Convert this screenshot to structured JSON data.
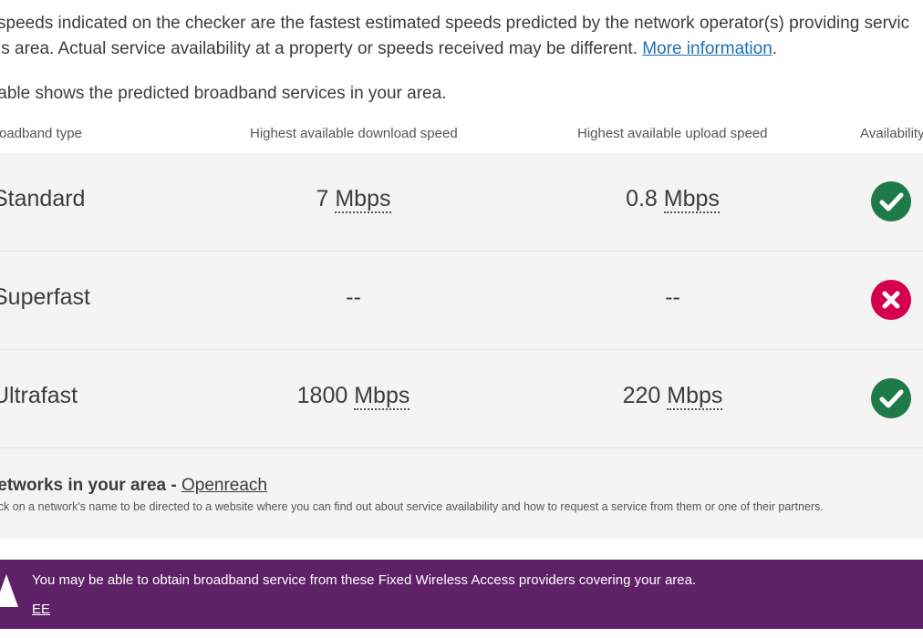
{
  "intro": {
    "line1": "speeds indicated on the checker are the fastest estimated speeds predicted by the network operator(s) providing servic",
    "line2_text": "is area. Actual service availability at a property or speeds received may be different.",
    "more_link": "More information",
    "line2_end": "."
  },
  "subtitle": "table shows the predicted broadband services in your area.",
  "table": {
    "headers": {
      "type": "roadband type",
      "download": "Highest available download speed",
      "upload": "Highest available upload speed",
      "availability": "Availability"
    },
    "rows": [
      {
        "type": "Standard",
        "down_value": "7",
        "down_unit": "Mbps",
        "up_value": "0.8",
        "up_unit": "Mbps",
        "available": true,
        "status_icon": "check-circle-icon"
      },
      {
        "type": "Superfast",
        "down_value": "--",
        "down_unit": "",
        "up_value": "--",
        "up_unit": "",
        "available": false,
        "status_icon": "cross-circle-icon"
      },
      {
        "type": "Ultrafast",
        "down_value": "1800",
        "down_unit": "Mbps",
        "up_value": "220",
        "up_unit": "Mbps",
        "available": true,
        "status_icon": "check-circle-icon"
      }
    ]
  },
  "networks": {
    "title": "letworks in your area - ",
    "link": "Openreach",
    "help": "ick on a network's name to be directed to a website where you can find out about service availability and how to request a service from them or one of their partners."
  },
  "banner": {
    "text": "You may be able to obtain broadband service from these Fixed Wireless Access providers covering your area.",
    "link": "EE",
    "icon": "warning-icon"
  },
  "colors": {
    "available": "#1f7a4a",
    "unavailable": "#d4004b",
    "banner_bg": "#5e2167",
    "link": "#1d70b8"
  }
}
